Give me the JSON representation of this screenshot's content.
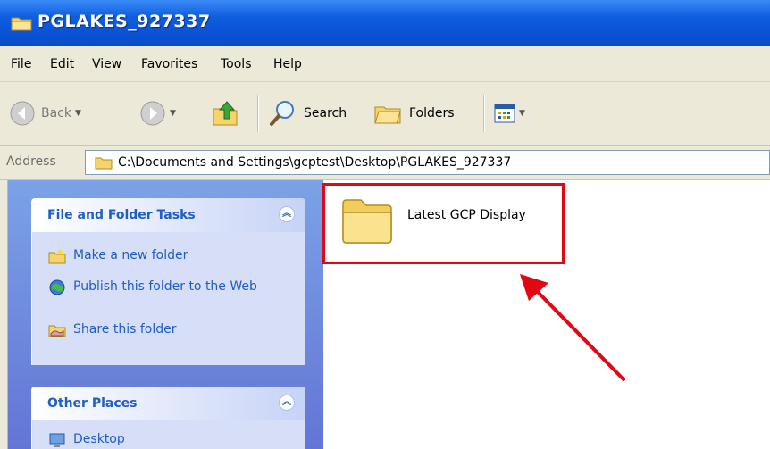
{
  "window": {
    "title": "PGLAKES_927337"
  },
  "menu": [
    "File",
    "Edit",
    "View",
    "Favorites",
    "Tools",
    "Help"
  ],
  "toolbar": {
    "back_label": "Back",
    "search_label": "Search",
    "folders_label": "Folders"
  },
  "address": {
    "label": "Address",
    "path": "C:\\Documents and Settings\\gcptest\\Desktop\\PGLAKES_927337"
  },
  "tasks_panel": {
    "title": "File and Folder Tasks",
    "items": [
      "Make a new folder",
      "Publish this folder to the Web",
      "Share this folder"
    ]
  },
  "places_panel": {
    "title": "Other Places",
    "items": [
      "Desktop"
    ]
  },
  "files": [
    {
      "name": "Latest GCP Display",
      "icon": "folder-icon"
    }
  ],
  "colors": {
    "highlight": "#e30613",
    "title_bar": "#0a52d6",
    "link": "#215dc6"
  }
}
